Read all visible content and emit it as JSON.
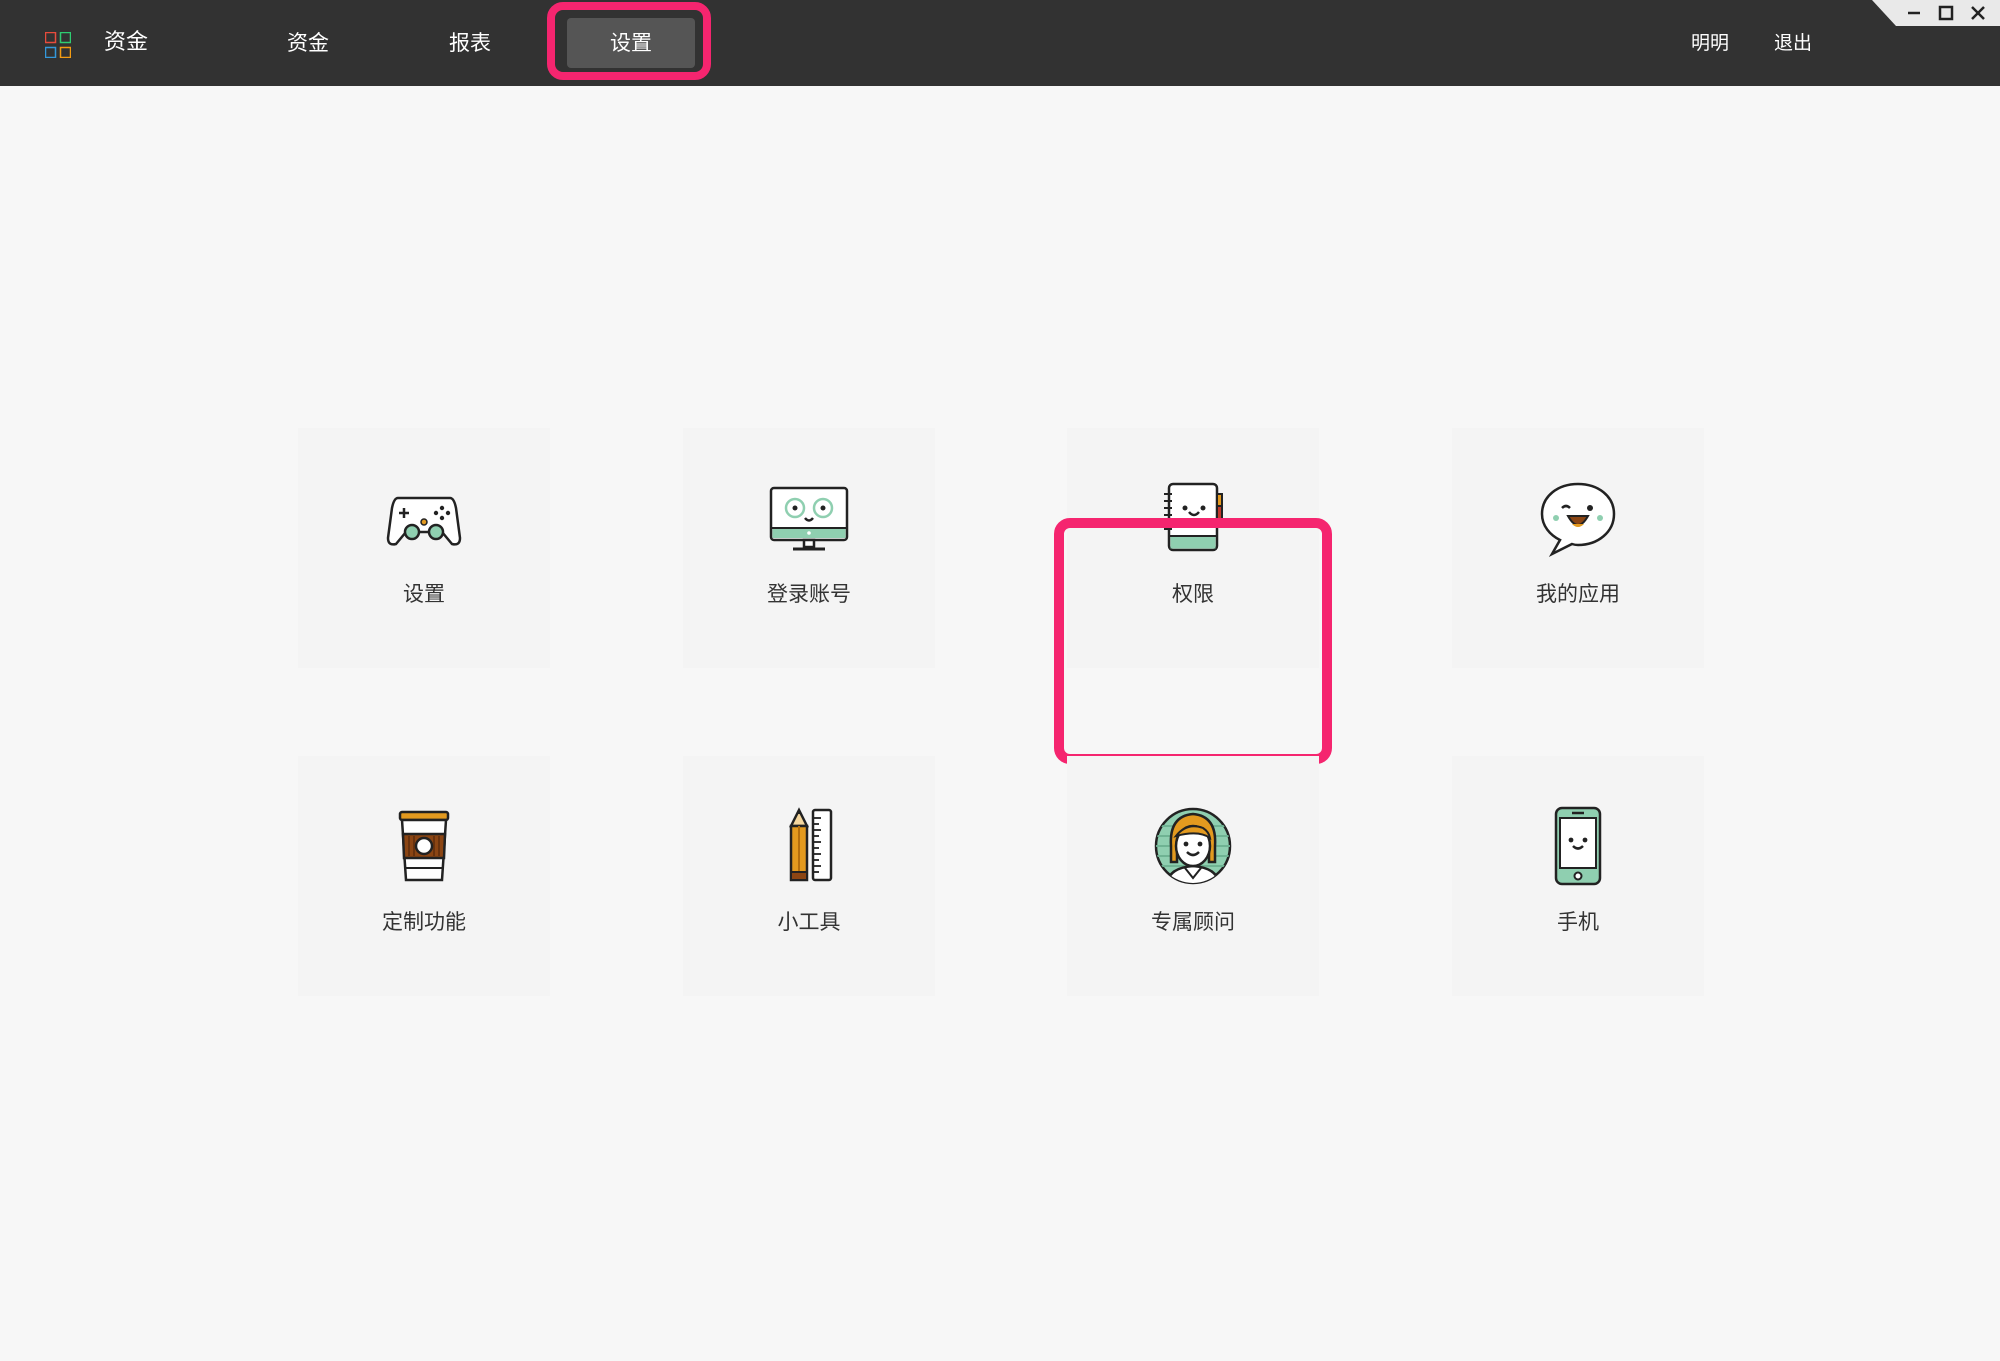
{
  "app": {
    "title": "资金",
    "logo_icon": "app-grid-icon"
  },
  "nav": {
    "items": [
      {
        "label": "资金"
      },
      {
        "label": "报表"
      },
      {
        "label": "设置",
        "active": true
      }
    ]
  },
  "user": {
    "name": "明明",
    "logout": "退出"
  },
  "window_controls": [
    "minimize-icon",
    "maximize-icon",
    "close-icon"
  ],
  "tiles": [
    {
      "label": "设置",
      "icon": "gamepad-icon"
    },
    {
      "label": "登录账号",
      "icon": "monitor-icon"
    },
    {
      "label": "权限",
      "icon": "notebook-icon"
    },
    {
      "label": "我的应用",
      "icon": "chat-bubble-icon"
    },
    {
      "label": "定制功能",
      "icon": "coffee-cup-icon"
    },
    {
      "label": "小工具",
      "icon": "pencil-ruler-icon"
    },
    {
      "label": "专属顾问",
      "icon": "advisor-avatar-icon"
    },
    {
      "label": "手机",
      "icon": "mobile-phone-icon"
    }
  ],
  "colors": {
    "topbar": "#323232",
    "highlight": "#f5256f",
    "background": "#f7f7f7",
    "accent_green": "#8fcfb0",
    "accent_orange": "#e39a1f"
  }
}
